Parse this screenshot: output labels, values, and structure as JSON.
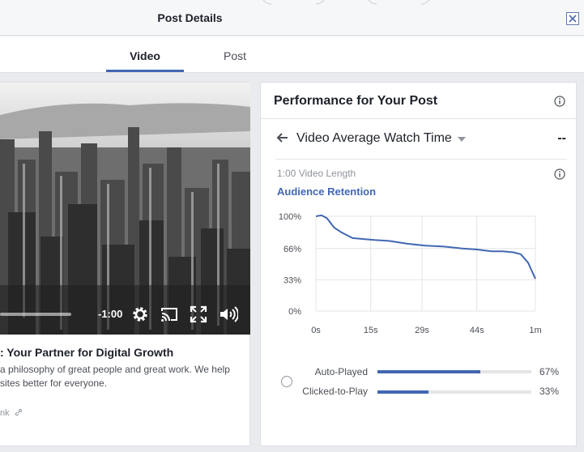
{
  "dialog": {
    "title": "Post Details",
    "close_icon": "close-icon"
  },
  "tabs": [
    {
      "label": "Video",
      "active": true
    },
    {
      "label": "Post",
      "active": false
    }
  ],
  "video": {
    "time_remaining": "-1:00",
    "controls": [
      "gear-icon",
      "cast-icon",
      "fullscreen-icon",
      "volume-icon"
    ],
    "post_title": ": Your Partner for Digital Growth",
    "description_lines": [
      "a philosophy of great people and great work. We help",
      "sites better for everyone."
    ],
    "link_text": "nk"
  },
  "performance": {
    "title": "Performance for Your Post",
    "metric_title": "Video Average Watch Time",
    "metric_value": "--",
    "video_length": "1:00 Video Length",
    "retention_label": "Audience Retention",
    "accent_color": "#4267b2"
  },
  "chart_data": {
    "type": "line",
    "title": "Audience Retention",
    "x_ticks": [
      "0s",
      "15s",
      "29s",
      "44s",
      "1m"
    ],
    "y_ticks": [
      "100%",
      "66%",
      "33%",
      "0%"
    ],
    "xlim": [
      0,
      60
    ],
    "ylim": [
      0,
      100
    ],
    "grid": true,
    "series": [
      {
        "x": [
          0,
          1.5,
          3,
          5,
          7,
          10,
          13,
          16,
          20,
          25,
          30,
          35,
          40,
          44,
          48,
          51,
          54,
          56,
          58,
          60
        ],
        "y": [
          100,
          101,
          98,
          88,
          83,
          77,
          76,
          75,
          74,
          71,
          69,
          68,
          66,
          65,
          63,
          63,
          62,
          60,
          51,
          34
        ]
      }
    ]
  },
  "breakdown": [
    {
      "label": "Auto-Played",
      "value": 67,
      "display": "67%"
    },
    {
      "label": "Clicked-to-Play",
      "value": 33,
      "display": "33%"
    }
  ]
}
